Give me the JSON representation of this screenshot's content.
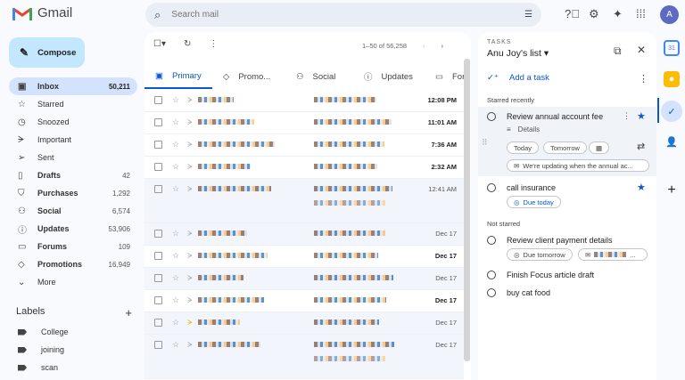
{
  "app": {
    "name": "Gmail",
    "avatar_letter": "A"
  },
  "search": {
    "placeholder": "Search mail"
  },
  "compose_label": "Compose",
  "nav": [
    {
      "icon": "inbox-icon",
      "glyph": "▣",
      "label": "Inbox",
      "count": "50,211",
      "active": true,
      "bold": true
    },
    {
      "icon": "star-icon",
      "glyph": "☆",
      "label": "Starred",
      "count": ""
    },
    {
      "icon": "clock-icon",
      "glyph": "◷",
      "label": "Snoozed",
      "count": ""
    },
    {
      "icon": "important-icon",
      "glyph": "ᗒ",
      "label": "Important",
      "count": ""
    },
    {
      "icon": "send-icon",
      "glyph": "➢",
      "label": "Sent",
      "count": ""
    },
    {
      "icon": "draft-icon",
      "glyph": "▯",
      "label": "Drafts",
      "count": "42",
      "bold": true
    },
    {
      "icon": "bag-icon",
      "glyph": "⛉",
      "label": "Purchases",
      "count": "1,292",
      "bold": true
    },
    {
      "icon": "people-icon",
      "glyph": "⚇",
      "label": "Social",
      "count": "6,574",
      "bold": true
    },
    {
      "icon": "info-icon",
      "glyph": "ⓘ",
      "label": "Updates",
      "count": "53,906",
      "bold": true
    },
    {
      "icon": "forum-icon",
      "glyph": "▭",
      "label": "Forums",
      "count": "109",
      "bold": true
    },
    {
      "icon": "tag-icon",
      "glyph": "◇",
      "label": "Promotions",
      "count": "16,949",
      "bold": true
    },
    {
      "icon": "chevron-down-icon",
      "glyph": "⌄",
      "label": "More",
      "count": ""
    }
  ],
  "labels": {
    "title": "Labels",
    "items": [
      "College",
      "joining",
      "scan"
    ]
  },
  "list": {
    "pager": "1–50 of 56,258",
    "tabs": [
      {
        "label": "Primary",
        "icon": "inbox-icon",
        "glyph": "▣"
      },
      {
        "label": "Promo...",
        "icon": "tag-icon",
        "glyph": "◇"
      },
      {
        "label": "Social",
        "icon": "people-icon",
        "glyph": "⚇"
      },
      {
        "label": "Updates",
        "icon": "info-icon",
        "glyph": "ⓘ"
      },
      {
        "label": "For",
        "icon": "forum-icon",
        "glyph": "▭"
      }
    ],
    "rows": [
      {
        "time": "12:08 PM",
        "unread": true
      },
      {
        "time": "11:01 AM",
        "unread": true
      },
      {
        "time": "7:36 AM",
        "unread": true
      },
      {
        "time": "2:32 AM",
        "unread": true
      },
      {
        "time": "12:41 AM",
        "unread": false,
        "tall": true
      },
      {
        "time": "Dec 17",
        "unread": false
      },
      {
        "time": "Dec 17",
        "unread": true
      },
      {
        "time": "Dec 17",
        "unread": false
      },
      {
        "time": "Dec 17",
        "unread": true
      },
      {
        "time": "Dec 17",
        "unread": false,
        "important": true
      },
      {
        "time": "Dec 17",
        "unread": false,
        "tall": true
      }
    ]
  },
  "tasks": {
    "header": "TASKS",
    "list_name": "Anu Joy's list",
    "add": "Add a task",
    "starred_heading": "Starred recently",
    "not_starred_heading": "Not starred",
    "t1": {
      "title": "Review annual account fee",
      "details": "Details",
      "chip_today": "Today",
      "chip_tomorrow": "Tomorrow",
      "email": "We're updating when the annual ac..."
    },
    "t2": {
      "title": "call insurance",
      "due": "Due today"
    },
    "t3": {
      "title": "Review client payment details",
      "due": "Due tomorrow",
      "email_more": "..."
    },
    "t4": {
      "title": "Finish Focus article draft"
    },
    "t5": {
      "title": "buy cat food"
    }
  },
  "colors": {
    "accent": "#0b57d0",
    "active_nav": "#d3e3fd",
    "compose": "#c2e7ff"
  }
}
